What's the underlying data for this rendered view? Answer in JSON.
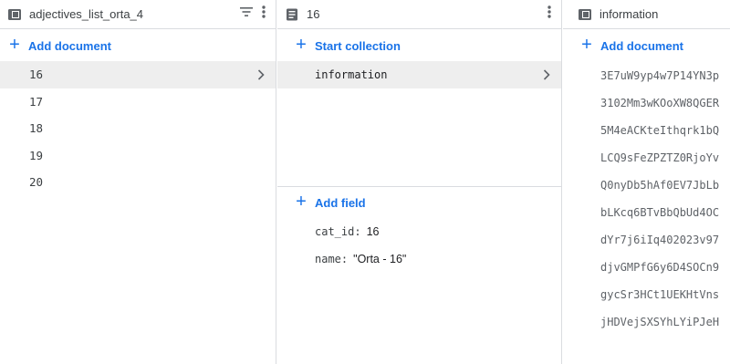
{
  "left_panel": {
    "title": "adjectives_list_orta_4",
    "add_label": "Add document",
    "documents": [
      "16",
      "17",
      "18",
      "19",
      "20"
    ],
    "selected": "16"
  },
  "middle_panel": {
    "title": "16",
    "add_collection_label": "Start collection",
    "collections": [
      "information"
    ],
    "add_field_label": "Add field",
    "fields": [
      {
        "key": "cat_id",
        "value": "16"
      },
      {
        "key": "name",
        "value": "\"Orta - 16\""
      }
    ]
  },
  "right_panel": {
    "title": "information",
    "add_label": "Add document",
    "documents": [
      "3E7uW9yp4w7P14YN3p",
      "3102Mm3wKOoXW8QGER",
      "5M4eACKteIthqrk1bQ",
      "LCQ9sFeZPZTZ0RjoYv",
      "Q0nyDb5hAf0EV7JbLb",
      "bLKcq6BTvBbQbUd4OC",
      "dYr7j6iIq402023v97",
      "djvGMPfG6y6D4SOCn9",
      "gycSr3HCt1UEKHtVns",
      "jHDVejSXSYhLYiPJeH"
    ]
  },
  "colors": {
    "accent": "#1a73e8",
    "selected_bg": "#eeeeee",
    "border": "#dadce0"
  }
}
